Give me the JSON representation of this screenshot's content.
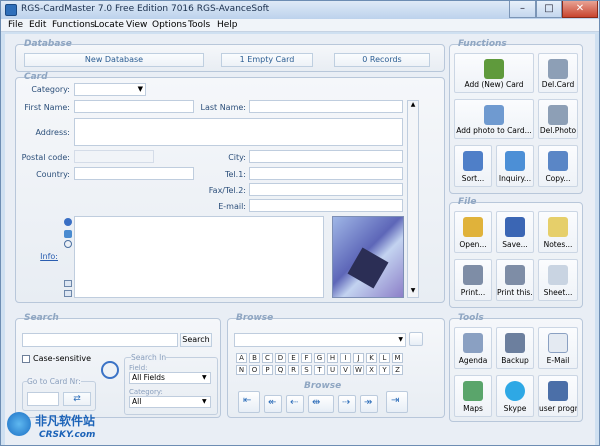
{
  "window": {
    "title": "RGS-CardMaster 7.0 Free Edition 7016 RGS-AvanceSoft",
    "min": "–",
    "max": "□",
    "close": "✕"
  },
  "menu": [
    "File",
    "Edit",
    "Functions",
    "Locate",
    "View",
    "Options",
    "Tools",
    "Help"
  ],
  "database": {
    "title": "Database",
    "name": "New Database",
    "cards": "1 Empty Card",
    "records": "0 Records"
  },
  "card": {
    "title": "Card",
    "labels": {
      "category": "Category:",
      "first_name": "First Name:",
      "last_name": "Last Name:",
      "address": "Address:",
      "postal_code": "Postal code:",
      "city": "City:",
      "country": "Country:",
      "tel1": "Tel.1:",
      "fax": "Fax/Tel.2:",
      "email": "E-mail:",
      "info": "Info:"
    }
  },
  "functions": {
    "title": "Functions",
    "buttons": [
      "Add (New) Card",
      "Del.Card",
      "Add photo to Card...",
      "Del.Photo",
      "Sort...",
      "Inquiry...",
      "Copy..."
    ]
  },
  "file": {
    "title": "File",
    "buttons": [
      "Open...",
      "Save...",
      "Notes...",
      "Print...",
      "Print this...",
      "Sheet..."
    ]
  },
  "tools": {
    "title": "Tools",
    "buttons": [
      "Agenda",
      "Backup",
      "E-Mail",
      "Maps",
      "Skype",
      "user program"
    ]
  },
  "search": {
    "title": "Search",
    "button": "Search",
    "case_sensitive": "Case-sensitive",
    "search_in": "Search In",
    "field_label": "Field:",
    "field_value": "All Fields",
    "category_label": "Category:",
    "category_value": "All",
    "goto_label": "Go to Card Nr:"
  },
  "browse": {
    "title": "Browse",
    "sub_title": "Browse",
    "letters": [
      "A",
      "B",
      "C",
      "D",
      "E",
      "F",
      "G",
      "H",
      "I",
      "J",
      "K",
      "L",
      "M",
      "N",
      "O",
      "P",
      "Q",
      "R",
      "S",
      "T",
      "U",
      "V",
      "W",
      "X",
      "Y",
      "Z"
    ]
  },
  "watermark": {
    "cn": "非凡软件站",
    "en": "CRSKY.com"
  }
}
